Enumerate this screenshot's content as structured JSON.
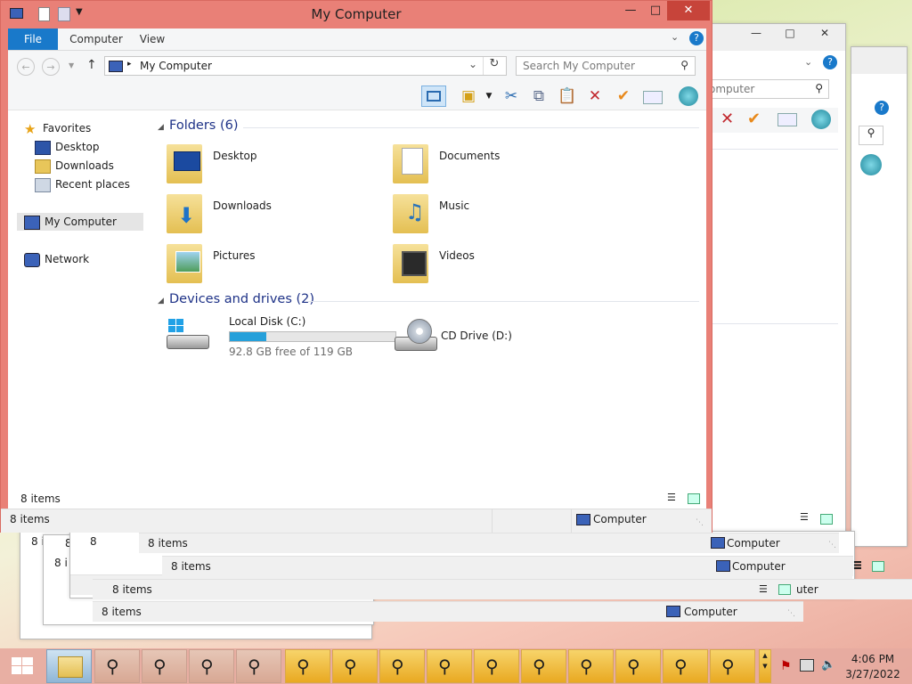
{
  "main_window": {
    "title": "My Computer",
    "ribbon_tabs": [
      "File",
      "Computer",
      "View"
    ],
    "address_path": "My Computer",
    "search_placeholder": "Search My Computer",
    "nav": {
      "favorites": "Favorites",
      "desktop": "Desktop",
      "downloads": "Downloads",
      "recent": "Recent places",
      "my_computer": "My Computer",
      "network": "Network"
    },
    "folders_header": "Folders (6)",
    "folders": [
      "Desktop",
      "Documents",
      "Downloads",
      "Music",
      "Pictures",
      "Videos"
    ],
    "drives_header": "Devices and drives (2)",
    "drive_c": {
      "name": "Local Disk (C:)",
      "free_text": "92.8 GB free of 119 GB",
      "used_fraction": 0.22
    },
    "drive_d": {
      "name": "CD Drive (D:)"
    },
    "status_items": "8 items",
    "status_items_2": "8 items",
    "status_location": "Computer"
  },
  "bg_windows": {
    "search_partial": "omputer",
    "bar1_items": "8 items",
    "bar1_loc": "Computer",
    "bar2_items": "8 items",
    "bar2_loc": "Computer",
    "bar3_items": "8 items",
    "bar3_loc": "uter",
    "bar4_items": "8 items",
    "bar4_loc": "Computer",
    "trunc1": "8 it",
    "trunc2": "8",
    "trunc3": "8 i",
    "trunc4": "8"
  },
  "taskbar": {
    "time": "4:06 PM",
    "date": "3/27/2022"
  },
  "colors": {
    "active_border": "#e98077",
    "accent": "#1979ca",
    "close_button": "#c7443a",
    "group_header": "#1e3287"
  }
}
